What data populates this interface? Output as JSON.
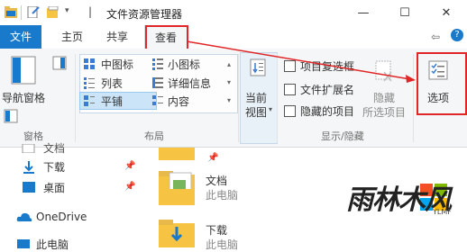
{
  "window": {
    "title": "文件资源管理器"
  },
  "tabs": [
    {
      "label": "文件"
    },
    {
      "label": "主页"
    },
    {
      "label": "共享"
    },
    {
      "label": "查看"
    }
  ],
  "ribbon": {
    "panes": {
      "nav_pane_label": "导航窗格",
      "group_label": "窗格"
    },
    "layout": {
      "items": {
        "medium_icons": "中图标",
        "small_icons": "小图标",
        "list": "列表",
        "details": "详细信息",
        "tiles": "平铺",
        "content": "内容"
      },
      "group_label": "布局"
    },
    "current_view": {
      "label_line1": "当前",
      "label_line2": "视图"
    },
    "show_hide": {
      "item_checkboxes": "项目复选框",
      "file_extensions": "文件扩展名",
      "hidden_items": "隐藏的项目",
      "hide_selected_line1": "隐藏",
      "hide_selected_line2": "所选项目",
      "group_label": "显示/隐藏"
    },
    "options": {
      "label": "选项"
    }
  },
  "nav_pane": {
    "items": [
      {
        "label": "文档"
      },
      {
        "label": "下载"
      },
      {
        "label": "桌面"
      },
      {
        "label": "OneDrive"
      },
      {
        "label": "此电脑"
      }
    ]
  },
  "content": {
    "items": [
      {
        "name": "文档",
        "location": "此电脑"
      },
      {
        "name": "下载",
        "location": "此电脑"
      }
    ]
  },
  "watermark": {
    "text": "雨林木风",
    "sub": "YLMF"
  },
  "colors": {
    "accent": "#1979ca",
    "highlight": "#e02626",
    "folder": "#f6c342"
  }
}
